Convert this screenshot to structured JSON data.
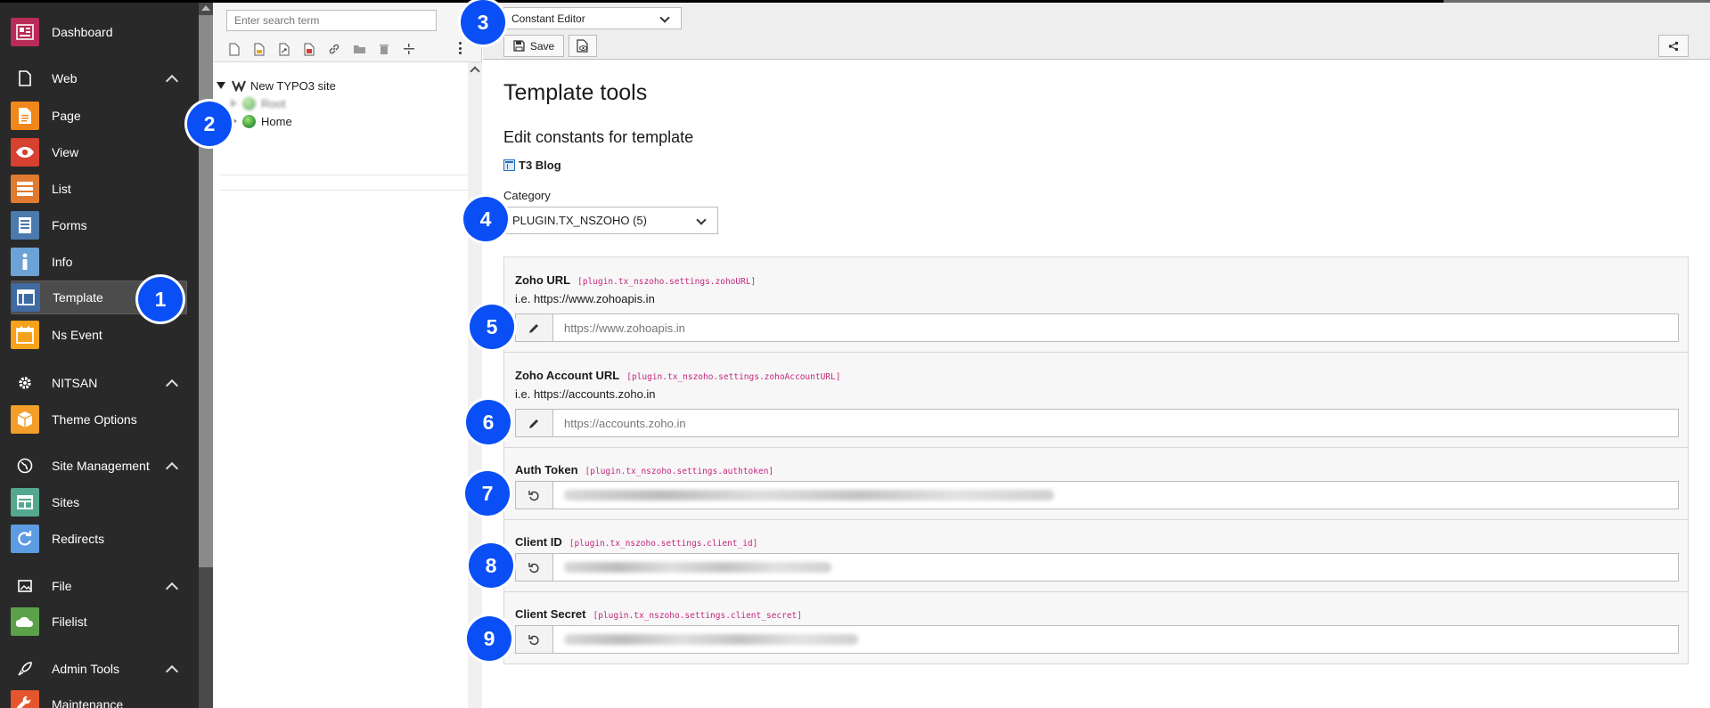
{
  "module_menu": {
    "items": [
      {
        "label": "Dashboard",
        "icon": "dashboard-icon",
        "color": "#b82c57"
      },
      {
        "label": "Web",
        "icon": "file-icon",
        "group": true
      },
      {
        "label": "Page",
        "icon": "page-icon",
        "color": "#f18619"
      },
      {
        "label": "View",
        "icon": "eye-icon",
        "color": "#d7412f"
      },
      {
        "label": "List",
        "icon": "list-icon",
        "color": "#e07a30"
      },
      {
        "label": "Forms",
        "icon": "forms-icon",
        "color": "#4b7aad"
      },
      {
        "label": "Info",
        "icon": "info-icon",
        "color": "#6ca2d5"
      },
      {
        "label": "Template",
        "icon": "template-icon",
        "color": "#3f6aa2",
        "active": true
      },
      {
        "label": "Ns Event",
        "icon": "calendar-icon",
        "color": "#f6a21a"
      },
      {
        "label": "NITSAN",
        "icon": "gear-icon",
        "group": true
      },
      {
        "label": "Theme Options",
        "icon": "box-icon",
        "color": "#f39e29"
      },
      {
        "label": "Site Management",
        "icon": "globe-icon",
        "group": true
      },
      {
        "label": "Sites",
        "icon": "sites-icon",
        "color": "#54a88f"
      },
      {
        "label": "Redirects",
        "icon": "redirect-icon",
        "color": "#5d9be3"
      },
      {
        "label": "File",
        "icon": "image-icon",
        "group": true
      },
      {
        "label": "Filelist",
        "icon": "filelist-icon",
        "color": "#5ba14a"
      },
      {
        "label": "Admin Tools",
        "icon": "rocket-icon",
        "group": true
      },
      {
        "label": "Maintenance",
        "icon": "wrench-icon",
        "color": "#e4572e"
      }
    ]
  },
  "page_tree": {
    "search_placeholder": "Enter search term",
    "root_label": "New TYPO3 site",
    "child_root": "Root",
    "child_home": "Home"
  },
  "docheader": {
    "function_select": "Constant Editor",
    "save_label": "Save"
  },
  "content": {
    "title": "Template tools",
    "subtitle": "Edit constants for template",
    "template_name": "T3 Blog",
    "category_label": "Category",
    "category_value": "PLUGIN.TX_NSZOHO (5)",
    "constants": [
      {
        "title": "Zoho URL",
        "key": "[plugin.tx_nszoho.settings.zohoURL]",
        "desc": "i.e. https://www.zohoapis.in",
        "value": "https://www.zohoapis.in"
      },
      {
        "title": "Zoho Account URL",
        "key": "[plugin.tx_nszoho.settings.zohoAccountURL]",
        "desc": "i.e. https://accounts.zoho.in",
        "value": "https://accounts.zoho.in"
      },
      {
        "title": "Auth Token",
        "key": "[plugin.tx_nszoho.settings.authtoken]"
      },
      {
        "title": "Client ID",
        "key": "[plugin.tx_nszoho.settings.client_id]"
      },
      {
        "title": "Client Secret",
        "key": "[plugin.tx_nszoho.settings.client_secret]"
      }
    ]
  },
  "markers": [
    "1",
    "2",
    "3",
    "4",
    "5",
    "6",
    "7",
    "8",
    "9"
  ]
}
